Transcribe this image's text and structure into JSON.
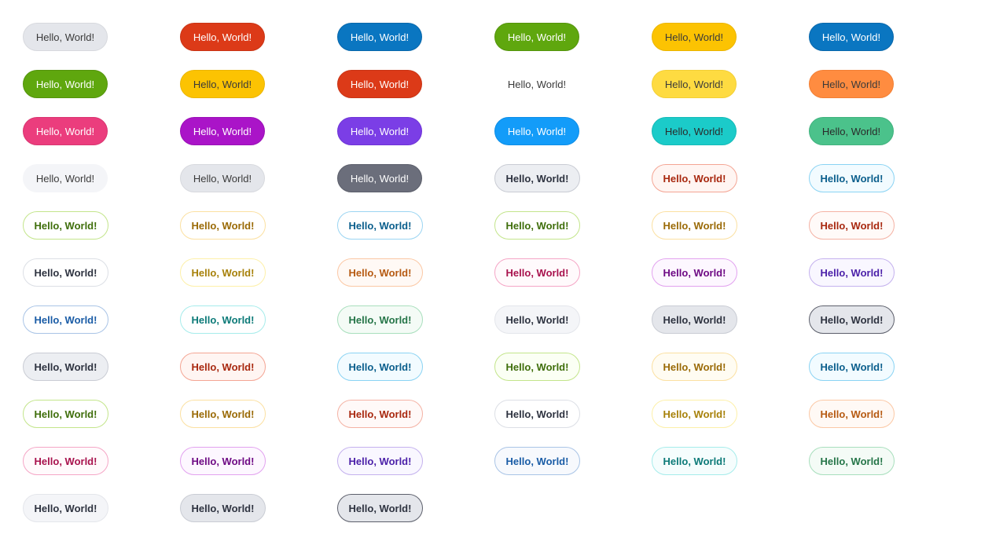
{
  "tags": [
    {
      "label": "Hello, World!",
      "bg": "#e4e6eb",
      "fg": "#3a3a3a",
      "border": "#d7d9de",
      "bold": false
    },
    {
      "label": "Hello, World!",
      "bg": "#dc3a18",
      "fg": "#ffffff",
      "border": "#c93415",
      "bold": false
    },
    {
      "label": "Hello, World!",
      "bg": "#0a76c1",
      "fg": "#ffffff",
      "border": "#0867ab",
      "bold": false
    },
    {
      "label": "Hello, World!",
      "bg": "#5fa70e",
      "fg": "#ffffff",
      "border": "#54940c",
      "bold": false
    },
    {
      "label": "Hello, World!",
      "bg": "#fcc302",
      "fg": "#3a3a3a",
      "border": "#ebb500",
      "bold": false
    },
    {
      "label": "Hello, World!",
      "bg": "#0a76c1",
      "fg": "#ffffff",
      "border": "#0867ab",
      "bold": false
    },
    {
      "label": "Hello, World!",
      "bg": "#5fa70e",
      "fg": "#ffffff",
      "border": "#54940c",
      "bold": false
    },
    {
      "label": "Hello, World!",
      "bg": "#fcc302",
      "fg": "#3a3a3a",
      "border": "#ebb500",
      "bold": false
    },
    {
      "label": "Hello, World!",
      "bg": "#dc3a18",
      "fg": "#ffffff",
      "border": "#c93415",
      "bold": false
    },
    {
      "label": "Hello, World!",
      "bg": "#ffffff",
      "fg": "#3a3a3a",
      "border": "#ffffff",
      "bold": false
    },
    {
      "label": "Hello, World!",
      "bg": "#fedb41",
      "fg": "#3a3a3a",
      "border": "#f3cf35",
      "bold": false
    },
    {
      "label": "Hello, World!",
      "bg": "#ff8c40",
      "fg": "#3a3a3a",
      "border": "#f27f34",
      "bold": false
    },
    {
      "label": "Hello, World!",
      "bg": "#eb3d7d",
      "fg": "#ffffff",
      "border": "#d93570",
      "bold": false
    },
    {
      "label": "Hello, World!",
      "bg": "#aa14c8",
      "fg": "#ffffff",
      "border": "#9a10b6",
      "bold": false
    },
    {
      "label": "Hello, World!",
      "bg": "#7b3ee6",
      "fg": "#ffffff",
      "border": "#6e34d6",
      "bold": false
    },
    {
      "label": "Hello, World!",
      "bg": "#139cf9",
      "fg": "#ffffff",
      "border": "#0d8de6",
      "bold": false
    },
    {
      "label": "Hello, World!",
      "bg": "#1bcbc9",
      "fg": "#2a2a2a",
      "border": "#15bab8",
      "bold": false
    },
    {
      "label": "Hello, World!",
      "bg": "#4bc28b",
      "fg": "#2a2a2a",
      "border": "#40b27e",
      "bold": false
    },
    {
      "label": "Hello, World!",
      "bg": "#f4f5f8",
      "fg": "#3a3a3a",
      "border": "#f4f5f8",
      "bold": false
    },
    {
      "label": "Hello, World!",
      "bg": "#e4e6eb",
      "fg": "#3a3a3a",
      "border": "#d7d9de",
      "bold": false
    },
    {
      "label": "Hello, World!",
      "bg": "#6b6e7b",
      "fg": "#ffffff",
      "border": "#5c5f6b",
      "bold": false
    },
    {
      "label": "Hello, World!",
      "bg": "#eceef2",
      "fg": "#2e3340",
      "border": "#c9ccd4",
      "bold": true
    },
    {
      "label": "Hello, World!",
      "bg": "#fff5f2",
      "fg": "#a8280f",
      "border": "#f4a594",
      "bold": true
    },
    {
      "label": "Hello, World!",
      "bg": "#f2fbff",
      "fg": "#0a5e8c",
      "border": "#8ad3f3",
      "bold": true
    },
    {
      "label": "Hello, World!",
      "bg": "#ffffff",
      "fg": "#3f6e0b",
      "border": "#c3e58b",
      "bold": true
    },
    {
      "label": "Hello, World!",
      "bg": "#ffffff",
      "fg": "#9a6a06",
      "border": "#fbe0a1",
      "bold": true
    },
    {
      "label": "Hello, World!",
      "bg": "#ffffff",
      "fg": "#0a5e8c",
      "border": "#9bd5f2",
      "bold": true
    },
    {
      "label": "Hello, World!",
      "bg": "#ffffff",
      "fg": "#3f6e0b",
      "border": "#c3e58b",
      "bold": true
    },
    {
      "label": "Hello, World!",
      "bg": "#ffffff",
      "fg": "#9a6a06",
      "border": "#fbe0a1",
      "bold": true
    },
    {
      "label": "Hello, World!",
      "bg": "#fffaf8",
      "fg": "#a8280f",
      "border": "#f4b2a4",
      "bold": true
    },
    {
      "label": "Hello, World!",
      "bg": "#ffffff",
      "fg": "#2e3340",
      "border": "#dcdfe5",
      "bold": true
    },
    {
      "label": "Hello, World!",
      "bg": "#ffffff",
      "fg": "#a7810a",
      "border": "#fdf0a8",
      "bold": true
    },
    {
      "label": "Hello, World!",
      "bg": "#fff9f5",
      "fg": "#b65a12",
      "border": "#fbc8a5",
      "bold": true
    },
    {
      "label": "Hello, World!",
      "bg": "#fffafc",
      "fg": "#a8124d",
      "border": "#f5a6c6",
      "bold": true
    },
    {
      "label": "Hello, World!",
      "bg": "#fdf7ff",
      "fg": "#6e0a84",
      "border": "#e2a2ef",
      "bold": true
    },
    {
      "label": "Hello, World!",
      "bg": "#f9f7ff",
      "fg": "#4a1fa8",
      "border": "#c4b1ee",
      "bold": true
    },
    {
      "label": "Hello, World!",
      "bg": "#ffffff",
      "fg": "#1a5ca6",
      "border": "#a9c4e6",
      "bold": true
    },
    {
      "label": "Hello, World!",
      "bg": "#ffffff",
      "fg": "#0c7a78",
      "border": "#a6eceb",
      "bold": true
    },
    {
      "label": "Hello, World!",
      "bg": "#f4fbf6",
      "fg": "#257548",
      "border": "#a8dfbd",
      "bold": true
    },
    {
      "label": "Hello, World!",
      "bg": "#f4f5f8",
      "fg": "#2e3340",
      "border": "#e4e6eb",
      "bold": true
    },
    {
      "label": "Hello, World!",
      "bg": "#e4e6eb",
      "fg": "#2e3340",
      "border": "#c9ccd4",
      "bold": true
    },
    {
      "label": "Hello, World!",
      "bg": "#e4e6eb",
      "fg": "#2e3340",
      "border": "#5c5f6b",
      "bold": true
    },
    {
      "label": "Hello, World!",
      "bg": "#eceef2",
      "fg": "#2e3340",
      "border": "#c9ccd4",
      "bold": true
    },
    {
      "label": "Hello, World!",
      "bg": "#fff5f2",
      "fg": "#a8280f",
      "border": "#f4a594",
      "bold": true
    },
    {
      "label": "Hello, World!",
      "bg": "#f2fbff",
      "fg": "#0a5e8c",
      "border": "#8ad3f3",
      "bold": true
    },
    {
      "label": "Hello, World!",
      "bg": "#fbfff4",
      "fg": "#3f6e0b",
      "border": "#c3e58b",
      "bold": true
    },
    {
      "label": "Hello, World!",
      "bg": "#fffcf2",
      "fg": "#9a6a06",
      "border": "#fbe0a1",
      "bold": true
    },
    {
      "label": "Hello, World!",
      "bg": "#f2fbff",
      "fg": "#0a5e8c",
      "border": "#8ad3f3",
      "bold": true
    },
    {
      "label": "Hello, World!",
      "bg": "#ffffff",
      "fg": "#3f6e0b",
      "border": "#c3e58b",
      "bold": true
    },
    {
      "label": "Hello, World!",
      "bg": "#ffffff",
      "fg": "#9a6a06",
      "border": "#fbe0a1",
      "bold": true
    },
    {
      "label": "Hello, World!",
      "bg": "#fff9f8",
      "fg": "#a8280f",
      "border": "#f4b2a4",
      "bold": true
    },
    {
      "label": "Hello, World!",
      "bg": "#ffffff",
      "fg": "#2e3340",
      "border": "#dcdfe5",
      "bold": true
    },
    {
      "label": "Hello, World!",
      "bg": "#ffffff",
      "fg": "#a7810a",
      "border": "#fdf0a8",
      "bold": true
    },
    {
      "label": "Hello, World!",
      "bg": "#fff9f5",
      "fg": "#b65a12",
      "border": "#fbc8a5",
      "bold": true
    },
    {
      "label": "Hello, World!",
      "bg": "#fffafc",
      "fg": "#a8124d",
      "border": "#f5a6c6",
      "bold": true
    },
    {
      "label": "Hello, World!",
      "bg": "#fdf7ff",
      "fg": "#6e0a84",
      "border": "#e2a2ef",
      "bold": true
    },
    {
      "label": "Hello, World!",
      "bg": "#f9f7ff",
      "fg": "#4a1fa8",
      "border": "#c4b1ee",
      "bold": true
    },
    {
      "label": "Hello, World!",
      "bg": "#f7f9fd",
      "fg": "#1a5ca6",
      "border": "#a9c4e6",
      "bold": true
    },
    {
      "label": "Hello, World!",
      "bg": "#f5fdfd",
      "fg": "#0c7a78",
      "border": "#a6eceb",
      "bold": true
    },
    {
      "label": "Hello, World!",
      "bg": "#f4fbf6",
      "fg": "#257548",
      "border": "#a8dfbd",
      "bold": true
    },
    {
      "label": "Hello, World!",
      "bg": "#f4f5f8",
      "fg": "#2e3340",
      "border": "#e4e6eb",
      "bold": true
    },
    {
      "label": "Hello, World!",
      "bg": "#e4e6eb",
      "fg": "#2e3340",
      "border": "#c9ccd4",
      "bold": true
    },
    {
      "label": "Hello, World!",
      "bg": "#e4e6eb",
      "fg": "#2e3340",
      "border": "#5c5f6b",
      "bold": true
    }
  ]
}
